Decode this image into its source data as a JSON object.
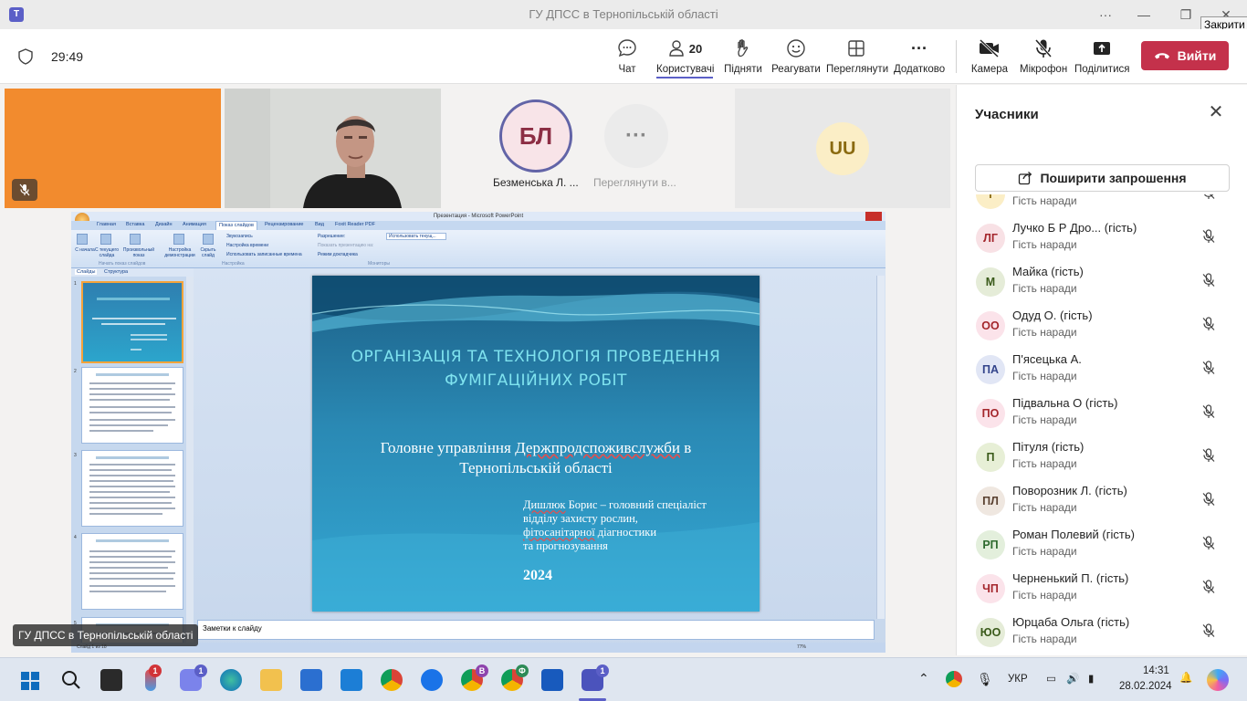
{
  "window": {
    "title": "ГУ ДПСС в Тернопільській області",
    "tooltip": "Закрити"
  },
  "toolbar": {
    "timer": "29:49",
    "chat_label": "Чат",
    "users_label": "Користувачі",
    "users_count": "20",
    "raise_label": "Підняти",
    "react_label": "Реагувати",
    "view_label": "Переглянути",
    "more_label": "Додатково",
    "camera_label": "Камера",
    "mic_label": "Мікрофон",
    "share_label": "Поділитися",
    "leave_label": "Вийти"
  },
  "video": {
    "tile_bl_initials": "БЛ",
    "tile_bl_name": "Безменська Л. ...",
    "tile_more_label": "Переглянути в...",
    "tile_uu_initials": "UU"
  },
  "shared_screen": {
    "caption": "ГУ ДПСС в Тернопільській області",
    "ppt_window_title": "Презентация - Microsoft PowerPoint",
    "ribbon_tabs": [
      "Главная",
      "Вставка",
      "Дизайн",
      "Анимация",
      "Показ слайдов",
      "Рецензирование",
      "Вид",
      "Foxit Reader PDF"
    ],
    "ribbon": {
      "from_start": "С начала",
      "from_current": "С текущего слайда",
      "custom_show": "Произвольный показ",
      "setup": "Настройка демонстрации",
      "hide_slide": "Скрыть слайд",
      "record": "Звукозапись",
      "rehearse": "Настройка времени",
      "use_timings": "Использовать записанные времена",
      "resolution": "Разрешение:",
      "resolution_value": "Использовать текущ...",
      "show_on": "Показать презентацию на:",
      "presenter_view": "Режим докладчика",
      "group_start": "Начать показ слайдов",
      "group_setup": "Настройка",
      "group_monitors": "Мониторы"
    },
    "left_tabs": [
      "Слайды",
      "Структура"
    ],
    "thumb_numbers": [
      "1",
      "2",
      "3",
      "4",
      "5"
    ],
    "notes_placeholder": "Заметки к слайду",
    "status_left": "Слайд 1 из 18",
    "status_zoom": "77%",
    "slide": {
      "title_line1": "ОРГАНІЗАЦІЯ ТА ТЕХНОЛОГІЯ ПРОВЕДЕННЯ",
      "title_line2": "ФУМІГАЦІЙНИХ РОБІТ",
      "org_line1_prefix": "Головне управління ",
      "org_line1_underlined": "Держпродспоживслужби",
      "org_line1_suffix": " в",
      "org_line2": "Тернопільській області",
      "author_surname": "Дишлюк",
      "author_line1_rest": " Борис – головний спеціаліст",
      "author_line2": "відділу захисту рослин,",
      "author_line3_underlined": "фітосанітарної",
      "author_line3_rest": " діагностики",
      "author_line4": "та прогнозування",
      "year": "2024"
    }
  },
  "panel": {
    "title": "Учасники",
    "invite_label": "Поширити запрошення",
    "participants": [
      {
        "initials": "Т",
        "name": "",
        "role": "Гість наради",
        "bg": "#fbeec6",
        "fg": "#8a6a10"
      },
      {
        "initials": "ЛГ",
        "name": "Лучко Б Р Дро... (гість)",
        "role": "Гість наради",
        "bg": "#f8e1e5",
        "fg": "#a4262c"
      },
      {
        "initials": "М",
        "name": "Майка (гість)",
        "role": "Гість наради",
        "bg": "#e5ecd8",
        "fg": "#3a5a1a"
      },
      {
        "initials": "ОО",
        "name": "Одуд О. (гість)",
        "role": "Гість наради",
        "bg": "#fbe3ea",
        "fg": "#a4262c"
      },
      {
        "initials": "ПА",
        "name": "П'ясецька А.",
        "role": "Гість наради",
        "bg": "#e1e6f5",
        "fg": "#33448b"
      },
      {
        "initials": "ПО",
        "name": "Підвальна О (гість)",
        "role": "Гість наради",
        "bg": "#fbe3ea",
        "fg": "#a4262c"
      },
      {
        "initials": "П",
        "name": "Пітуля (гість)",
        "role": "Гість наради",
        "bg": "#e7efd6",
        "fg": "#3a5a1a"
      },
      {
        "initials": "ПЛ",
        "name": "Поворозник Л. (гість)",
        "role": "Гість наради",
        "bg": "#efe7e0",
        "fg": "#5a4030"
      },
      {
        "initials": "РП",
        "name": "Роман Полевий (гість)",
        "role": "Гість наради",
        "bg": "#e3efdc",
        "fg": "#2e6a2e"
      },
      {
        "initials": "ЧП",
        "name": "Черненький П. (гість)",
        "role": "Гість наради",
        "bg": "#fbe3ea",
        "fg": "#a4262c"
      },
      {
        "initials": "ЮО",
        "name": "Юрцаба Ольга (гість)",
        "role": "Гість наради",
        "bg": "#e5ecd8",
        "fg": "#3a5a1a"
      }
    ]
  },
  "taskbar": {
    "lang": "УКР",
    "time": "14:31",
    "date": "28.02.2024",
    "badge_weather": "1",
    "badge_teams_chat": "1",
    "badge_chrome_b": "В",
    "badge_chrome_f": "Ф",
    "badge_teams": "1"
  }
}
